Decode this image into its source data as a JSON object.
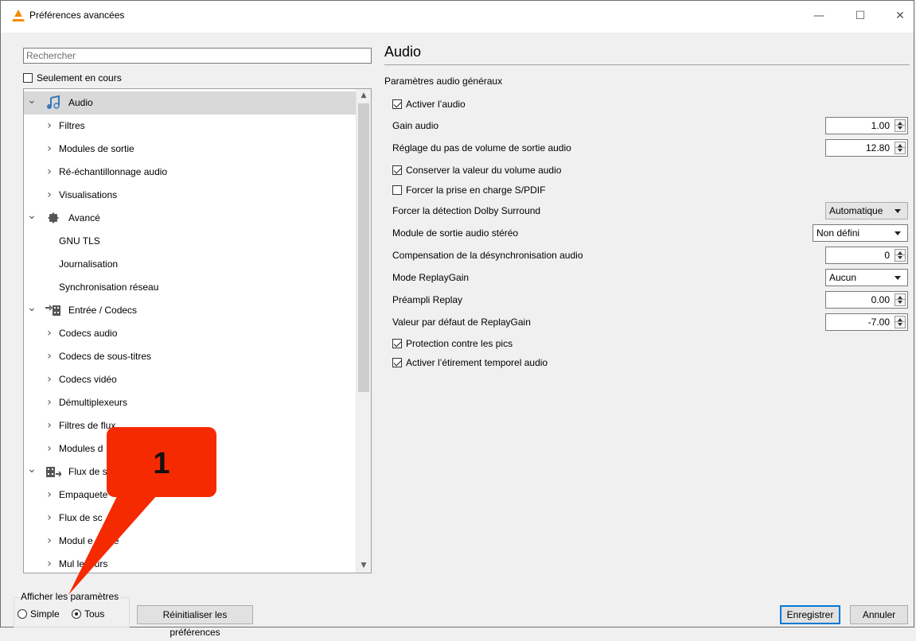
{
  "window": {
    "title": "Préférences avancées"
  },
  "left": {
    "search_placeholder": "Rechercher",
    "only_current": {
      "label": "Seulement en cours",
      "checked": false
    },
    "tree": [
      {
        "label": "Audio",
        "level": 0,
        "expanded": true,
        "icon": "music-note-icon",
        "selected": true
      },
      {
        "label": "Filtres",
        "level": 1,
        "expandable": true
      },
      {
        "label": "Modules de sortie",
        "level": 1,
        "expandable": true
      },
      {
        "label": "Ré-échantillonnage audio",
        "level": 1,
        "expandable": true
      },
      {
        "label": "Visualisations",
        "level": 1,
        "expandable": true
      },
      {
        "label": "Avancé",
        "level": 0,
        "expanded": true,
        "icon": "gear-icon"
      },
      {
        "label": "GNU TLS",
        "level": 1,
        "expandable": false
      },
      {
        "label": "Journalisation",
        "level": 1,
        "expandable": false
      },
      {
        "label": "Synchronisation réseau",
        "level": 1,
        "expandable": false
      },
      {
        "label": "Entrée / Codecs",
        "level": 0,
        "expanded": true,
        "icon": "input-codecs-icon"
      },
      {
        "label": "Codecs audio",
        "level": 1,
        "expandable": true
      },
      {
        "label": "Codecs de sous-titres",
        "level": 1,
        "expandable": true
      },
      {
        "label": "Codecs vidéo",
        "level": 1,
        "expandable": true
      },
      {
        "label": "Démultiplexeurs",
        "level": 1,
        "expandable": true
      },
      {
        "label": "Filtres de flux",
        "level": 1,
        "expandable": true
      },
      {
        "label": "Modules d",
        "level": 1,
        "expandable": true
      },
      {
        "label": "Flux de s",
        "level": 0,
        "expanded": true,
        "icon": "stream-output-icon"
      },
      {
        "label": "Empaquete",
        "level": 1,
        "expandable": true
      },
      {
        "label": "Flux de sc",
        "level": 1,
        "expandable": true
      },
      {
        "label": "Modul    e sortie",
        "level": 1,
        "expandable": true
      },
      {
        "label": "Mul   lexeurs",
        "level": 1,
        "expandable": true
      }
    ],
    "show_settings": {
      "title": "Afficher les paramètres",
      "simple": "Simple",
      "all": "Tous",
      "selected": "Tous"
    },
    "reset_label": "Réinitialiser les préférences"
  },
  "right": {
    "title": "Audio",
    "subtitle": "Paramètres audio généraux",
    "enable_audio": {
      "label": "Activer l’audio",
      "checked": true
    },
    "gain": {
      "label": "Gain audio",
      "value": "1.00"
    },
    "volume_step": {
      "label": "Réglage du pas de volume de sortie audio",
      "value": "12.80"
    },
    "keep_volume": {
      "label": "Conserver la valeur du volume audio",
      "checked": true
    },
    "force_spdif": {
      "label": "Forcer la prise en charge S/PDIF",
      "checked": false
    },
    "dolby": {
      "label": "Forcer la détection Dolby Surround",
      "value": "Automatique"
    },
    "stereo": {
      "label": "Module de sortie audio stéréo",
      "value": "Non défini"
    },
    "desync": {
      "label": "Compensation de la désynchronisation audio",
      "value": "0"
    },
    "replaygain_mode": {
      "label": "Mode ReplayGain",
      "value": "Aucun"
    },
    "preamp": {
      "label": "Préampli Replay",
      "value": "0.00"
    },
    "replaygain_default": {
      "label": "Valeur par défaut de ReplayGain",
      "value": "-7.00"
    },
    "peak_protection": {
      "label": "Protection contre les pics",
      "checked": true
    },
    "time_stretch": {
      "label": "Activer l’étirement temporel audio",
      "checked": true
    }
  },
  "footer": {
    "save_label": "Enregistrer",
    "cancel_label": "Annuler"
  },
  "annotation": {
    "label": "1",
    "color": "#f52a00"
  },
  "colors": {
    "selection": "#d9d9d9",
    "default_button_border": "#0078d7",
    "vlc_cone": "#f28a00"
  }
}
